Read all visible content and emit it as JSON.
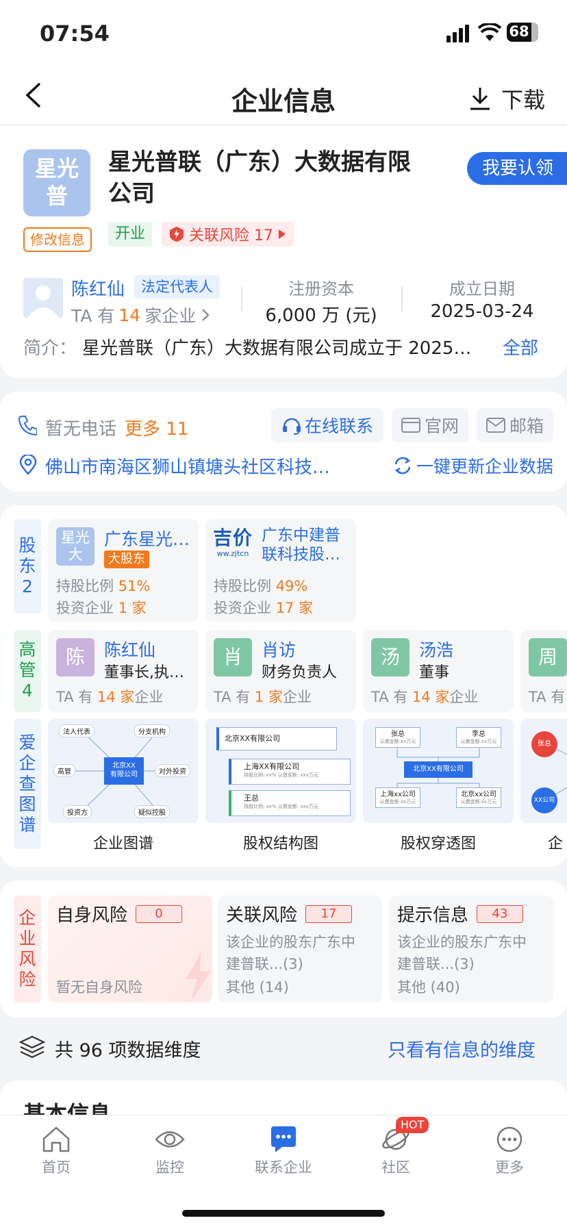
{
  "status_bar": {
    "time": "07:54",
    "battery": "68"
  },
  "nav": {
    "title": "企业信息",
    "download": "下载"
  },
  "company": {
    "logo_text": "星光\n普",
    "name": "星光普联（广东）大数据有限公司",
    "claim_button": "我要认领",
    "edit_info": "修改信息",
    "status_tag": "开业",
    "risk_tag": "关联风险 17",
    "legal_rep": {
      "avatar": "",
      "name": "陈红仙",
      "role": "法定代表人",
      "ta_prefix": "TA 有",
      "ta_count": "14",
      "ta_suffix": "家企业"
    },
    "reg_capital": {
      "label": "注册资本",
      "value": "6,000 万 (元)"
    },
    "found_date": {
      "label": "成立日期",
      "value": "2025-03-24"
    },
    "intro": {
      "label": "简介：",
      "text": "星光普联（广东）大数据有限公司成立于 2025…",
      "more": "全部"
    }
  },
  "contact": {
    "phone": "暂无电话",
    "more": "更多 11",
    "online": "在线联系",
    "website": "官网",
    "email": "邮箱",
    "address": "佛山市南海区狮山镇塘头社区科技…",
    "update": "一键更新企业数据"
  },
  "shareholders": {
    "side_label": "股\n东\n2",
    "items": [
      {
        "logo": "星光\n大",
        "name": "广东星光…",
        "badge": "大股东",
        "ratio_label": "持股比例 ",
        "ratio": "51%",
        "invest_label": "投资企业 ",
        "invest": "1 家"
      },
      {
        "logo": "吉价",
        "logo_sub": "ww.zjtcn",
        "name": "广东中建普联科技股…",
        "ratio_label": "持股比例 ",
        "ratio": "49%",
        "invest_label": "投资企业 ",
        "invest": "17 家"
      }
    ]
  },
  "executives": {
    "side_label": "高\n管\n4",
    "items": [
      {
        "avatar": "陈",
        "name": "陈红仙",
        "title": "董事长,执…",
        "ta_prefix": "TA 有 ",
        "ta_count": "14 家",
        "ta_suffix": "企业",
        "color": "#c9b3dc"
      },
      {
        "avatar": "肖",
        "name": "肖访",
        "title": "财务负责人",
        "ta_prefix": "TA 有 ",
        "ta_count": "1 家",
        "ta_suffix": "企业",
        "color": "#7fc7a4"
      },
      {
        "avatar": "汤",
        "name": "汤浩",
        "title": "董事",
        "ta_prefix": "TA 有 ",
        "ta_count": "14 家",
        "ta_suffix": "企业",
        "color": "#7fc7a4"
      },
      {
        "avatar": "周",
        "name": "",
        "title": "",
        "ta_prefix": "TA 有",
        "ta_count": "",
        "ta_suffix": "",
        "color": "#7fc7a4"
      }
    ]
  },
  "graphs": {
    "side_label": "爱\n企\n查\n图\n谱",
    "items": [
      {
        "label": "企业图谱",
        "center": "北京XX\n有限公司",
        "nodes": [
          "法人代表",
          "分支机构",
          "高管",
          "对外投资",
          "投资方",
          "疑似控股"
        ]
      },
      {
        "label": "股权结构图",
        "top": "北京XX有限公司",
        "sub1": "上海XX有限公司",
        "sub1_detail": "持股比例: xx%   认缴金额: xxx万元",
        "sub2": "王总",
        "sub2_detail": "持股比例: xx%   认缴金额: xxx万元"
      },
      {
        "label": "股权穿透图",
        "p1": "张总",
        "p1_detail": "认缴金额:xx万元",
        "p2": "李总",
        "p2_detail": "认缴金额:xx万元",
        "center": "北京XX有限公司",
        "c1": "上海xx公司",
        "c1_detail": "认缴金额:xx万元",
        "c2": "北京xx公司",
        "c2_detail": "认缴金额:xx万元"
      },
      {
        "label": "企",
        "n1": "张总",
        "n2": "XX公司"
      }
    ]
  },
  "risk": {
    "side_label": "企\n业\n风\n险",
    "items": [
      {
        "title": "自身风险",
        "count": "0",
        "line1": "",
        "line2": "",
        "line3": "暂无自身风险"
      },
      {
        "title": "关联风险",
        "count": "17",
        "line1": "该企业的股东广东中",
        "line2": "建普联...(3)",
        "line3": "其他 (14)"
      },
      {
        "title": "提示信息",
        "count": "43",
        "line1": "该企业的股东广东中",
        "line2": "建普联...(3)",
        "line3": "其他 (40)"
      }
    ]
  },
  "dimensions": {
    "text": "共 96 项数据维度",
    "link": "只看有信息的维度"
  },
  "basic_info": {
    "title": "基本信息"
  },
  "tabbar": {
    "items": [
      {
        "label": "首页"
      },
      {
        "label": "监控"
      },
      {
        "label": "联系企业"
      },
      {
        "label": "社区",
        "badge": "HOT"
      },
      {
        "label": "更多"
      }
    ]
  },
  "colors": {
    "accent": "#2b6de5",
    "orange": "#f07a1c",
    "red": "#e8453c",
    "green_bg": "#e8f6ec",
    "green": "#1f9d4e"
  }
}
